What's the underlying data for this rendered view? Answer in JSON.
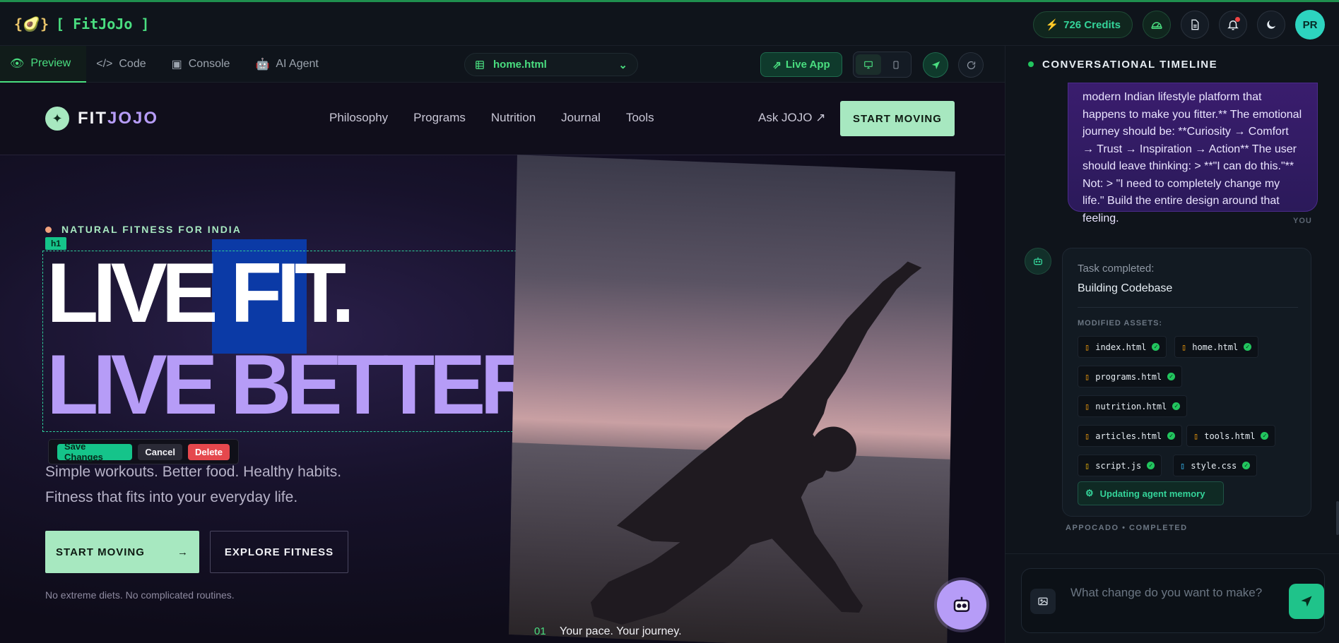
{
  "app": {
    "brand_glyph": "{🥑}",
    "brand_name": "[ FitJoJo ]",
    "credits": "726 Credits",
    "avatar_initials": "PR",
    "accent": "#4ade80"
  },
  "toolbar": {
    "tabs": [
      {
        "label": "Preview",
        "icon": "eye-icon",
        "active": true
      },
      {
        "label": "Code",
        "icon": "code-icon",
        "active": false
      },
      {
        "label": "Console",
        "icon": "terminal-icon",
        "active": false
      },
      {
        "label": "AI Agent",
        "icon": "robot-icon",
        "active": false
      }
    ],
    "file": "home.html",
    "live_app": "Live App"
  },
  "site": {
    "logo_fit": "FIT",
    "logo_jojo": "JOJO",
    "nav": [
      "Philosophy",
      "Programs",
      "Nutrition",
      "Journal",
      "Tools"
    ],
    "ask": "Ask JOJO ↗",
    "nav_cta": "START MOVING",
    "eyebrow": "NATURAL FITNESS FOR INDIA",
    "h1_tag": "h1",
    "headline_1": "LIVE FIT.",
    "headline_2": "LIVE BETTER.",
    "edit": {
      "save": "Save Changes",
      "cancel": "Cancel",
      "delete": "Delete"
    },
    "sub_1": "Simple workouts. Better food. Healthy habits.",
    "sub_2": "Fitness that fits into your everyday life.",
    "btn_primary": "START MOVING",
    "btn_primary_arrow": "→",
    "btn_outline": "EXPLORE FITNESS",
    "note": "No extreme diets. No complicated routines.",
    "caption_num": "01",
    "caption": "Your pace. Your journey."
  },
  "panel": {
    "title": "CONVERSATIONAL TIMELINE",
    "user_message": "modern Indian lifestyle platform that happens to make you fitter.** The emotional journey should be: **Curiosity → Comfort → Trust → Inspiration → Action** The user should leave thinking: > **\"I can do this.\"** Not: > \"I need to completely change my life.\" Build the entire design around that feeling.",
    "you_label": "YOU",
    "task_label": "Task completed:",
    "task_title": "Building Codebase",
    "modified_label": "MODIFIED ASSETS:",
    "assets": [
      "index.html",
      "home.html",
      "programs.html",
      "nutrition.html",
      "articles.html",
      "tools.html",
      "script.js",
      "style.css"
    ],
    "memory": "Updating agent memory",
    "status": "APPOCADO  •  COMPLETED",
    "placeholder": "What change do you want to make?"
  }
}
